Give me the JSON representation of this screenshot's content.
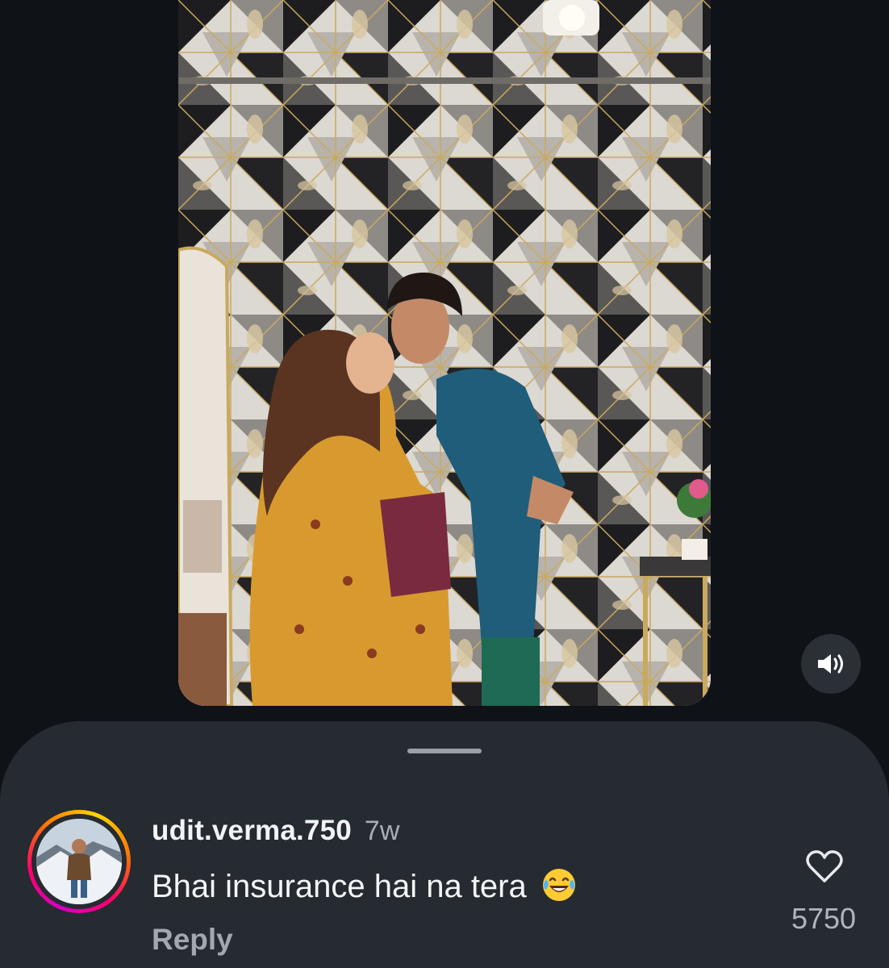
{
  "comment": {
    "username": "udit.verma.750",
    "age": "7w",
    "text": "Bhai insurance hai na tera",
    "emoji": "😂",
    "reply_label": "Reply",
    "like_count": "5750"
  },
  "icons": {
    "mute": "speaker-icon",
    "like": "heart-outline-icon",
    "emoji": "tears-of-joy-emoji"
  },
  "colors": {
    "background": "#0f1217",
    "sheet": "#262a31",
    "story_ring": [
      "#d300c5",
      "#ff0069",
      "#ff7a00",
      "#ffd600"
    ]
  }
}
